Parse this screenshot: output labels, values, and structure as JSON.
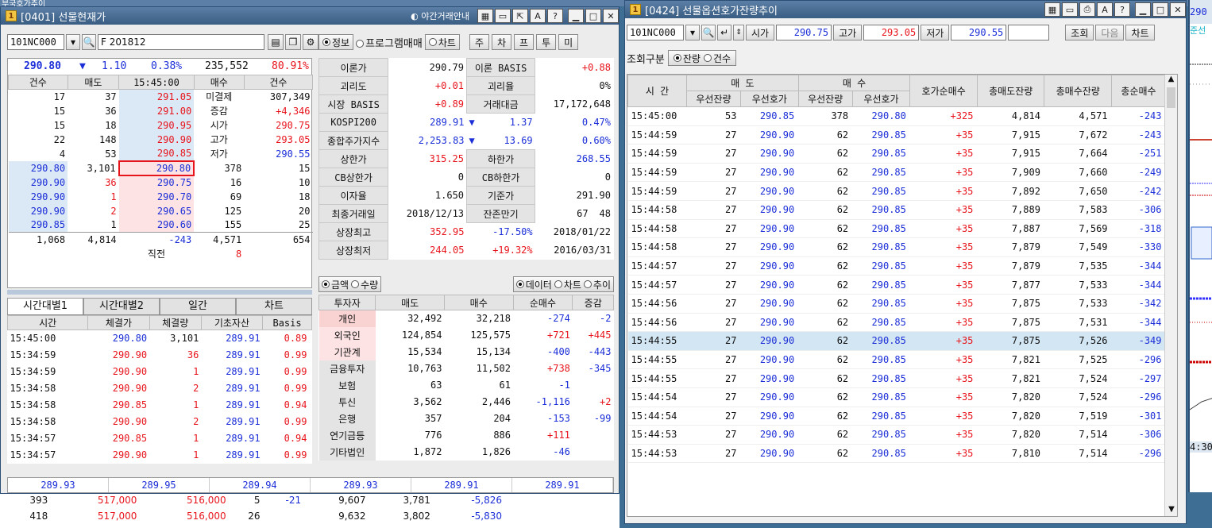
{
  "bg_title": "부국호가추이",
  "w1": {
    "title": "[0401] 선물현재가",
    "night": "야간거래안내",
    "code": "101NC000",
    "name": "F 201812",
    "radios": [
      "정보",
      "프로그램매매",
      "차트"
    ],
    "tabs": [
      "주",
      "차",
      "프",
      "투",
      "미"
    ],
    "hdr": {
      "price": "290.80",
      "chg": "1.10",
      "pct": "0.38%",
      "vol": "235,552",
      "rate": "80.91%"
    },
    "ob_head": [
      "건수",
      "매도",
      "15:45:00",
      "매수",
      "건수"
    ],
    "ask": [
      [
        "17",
        "37",
        "291.05"
      ],
      [
        "15",
        "36",
        "291.00"
      ],
      [
        "15",
        "18",
        "290.95"
      ],
      [
        "22",
        "148",
        "290.90"
      ],
      [
        "4",
        "53",
        "290.85"
      ]
    ],
    "info": [
      [
        "미결제",
        "307,349"
      ],
      [
        "증감",
        "+4,346"
      ],
      [
        "시가",
        "290.75"
      ],
      [
        "고가",
        "293.05"
      ],
      [
        "저가",
        "290.55"
      ]
    ],
    "bid": [
      [
        "290.80",
        "378",
        "15"
      ],
      [
        "290.75",
        "16",
        "10"
      ],
      [
        "290.70",
        "69",
        "18"
      ],
      [
        "290.65",
        "125",
        "20"
      ],
      [
        "290.60",
        "155",
        "25"
      ]
    ],
    "left_ticks": [
      [
        "290.80",
        "3,101"
      ],
      [
        "290.90",
        "36"
      ],
      [
        "290.90",
        "1"
      ],
      [
        "290.90",
        "2"
      ],
      [
        "290.85",
        "1"
      ]
    ],
    "sum": [
      "1,068",
      "4,814",
      "-243",
      "4,571",
      "654"
    ],
    "prev_label": "직전",
    "prev_val": "8",
    "tabs2": [
      "시간대별1",
      "시간대별2",
      "일간",
      "차트"
    ],
    "t_head": [
      "시간",
      "체결가",
      "체결량",
      "기초자산",
      "Basis"
    ],
    "t_rows": [
      [
        "15:45:00",
        "290.80",
        "3,101",
        "289.91",
        "0.89"
      ],
      [
        "15:34:59",
        "290.90",
        "36",
        "289.91",
        "0.99"
      ],
      [
        "15:34:59",
        "290.90",
        "1",
        "289.91",
        "0.99"
      ],
      [
        "15:34:58",
        "290.90",
        "2",
        "289.91",
        "0.99"
      ],
      [
        "15:34:58",
        "290.85",
        "1",
        "289.91",
        "0.94"
      ],
      [
        "15:34:58",
        "290.90",
        "2",
        "289.91",
        "0.99"
      ],
      [
        "15:34:57",
        "290.85",
        "1",
        "289.91",
        "0.94"
      ],
      [
        "15:34:57",
        "290.90",
        "1",
        "289.91",
        "0.99"
      ]
    ],
    "right_info": [
      [
        "이론가",
        "290.79",
        "이론 BASIS",
        "+0.88"
      ],
      [
        "괴리도",
        "+0.01",
        "괴리율",
        "0%"
      ],
      [
        "시장 BASIS",
        "+0.89",
        "거래대금",
        "17,172,648"
      ]
    ],
    "idx": [
      [
        "KOSPI200",
        "289.91",
        "1.37",
        "0.47%"
      ],
      [
        "종합주가지수",
        "2,253.83",
        "13.69",
        "0.60%"
      ]
    ],
    "limits": [
      [
        "상한가",
        "315.25",
        "하한가",
        "268.55"
      ],
      [
        "CB상한가",
        "0",
        "CB하한가",
        "0"
      ],
      [
        "이자율",
        "1.650",
        "기준가",
        "291.90"
      ],
      [
        "최종거래일",
        "2018/12/13",
        "잔존만기",
        "67",
        "48"
      ]
    ],
    "hilo": [
      [
        "상장최고",
        "352.95",
        "-17.50%",
        "2018/01/22"
      ],
      [
        "상장최저",
        "244.05",
        "+19.32%",
        "2016/03/31"
      ]
    ],
    "inv_radios": [
      "금액",
      "수량"
    ],
    "inv_radios2": [
      "데이터",
      "차트",
      "추이"
    ],
    "inv_head": [
      "투자자",
      "매도",
      "매수",
      "순매수",
      "증감"
    ],
    "inv": [
      [
        "개인",
        "32,492",
        "32,218",
        "-274",
        "-2"
      ],
      [
        "외국인",
        "124,854",
        "125,575",
        "+721",
        "+445"
      ],
      [
        "기관계",
        "15,534",
        "15,134",
        "-400",
        "-443"
      ],
      [
        "금융투자",
        "10,763",
        "11,502",
        "+738",
        "-345"
      ],
      [
        "보험",
        "63",
        "61",
        "-1",
        ""
      ],
      [
        "투신",
        "3,562",
        "2,446",
        "-1,116",
        "+2"
      ],
      [
        "은행",
        "357",
        "204",
        "-153",
        "-99"
      ],
      [
        "연기금등",
        "776",
        "886",
        "+111",
        ""
      ],
      [
        "기타법인",
        "1,872",
        "1,826",
        "-46",
        ""
      ]
    ],
    "foot": [
      "289.93",
      "289.95",
      "289.94",
      "289.93",
      "289.91",
      "289.91"
    ]
  },
  "bg_rows": [
    [
      "393",
      "517,000",
      "516,000",
      "5",
      "-21",
      "9,607",
      "3,781",
      "-5,826"
    ],
    [
      "418",
      "517,000",
      "516,000",
      "26",
      "",
      "9,632",
      "3,802",
      "-5,830"
    ]
  ],
  "w2": {
    "title": "[0424] 선물옵션호가잔량추이",
    "code": "101NC000",
    "lbl_open": "시가",
    "open": "290.75",
    "lbl_high": "고가",
    "high": "293.05",
    "lbl_low": "저가",
    "low": "290.55",
    "btn_query": "조회",
    "btn_next": "다음",
    "btn_chart": "차트",
    "cond_label": "조회구분",
    "cond": [
      "잔량",
      "건수"
    ],
    "h_time": "시 간",
    "h_sell": "매 도",
    "h_buy": "매 수",
    "h_sub": [
      "우선잔량",
      "우선호가",
      "우선잔량",
      "우선호가"
    ],
    "h_rest": [
      "호가순매수",
      "총매도잔량",
      "총매수잔량",
      "총순매수"
    ],
    "rows": [
      [
        "15:45:00",
        "53",
        "290.85",
        "378",
        "290.80",
        "+325",
        "4,814",
        "4,571",
        "-243"
      ],
      [
        "15:44:59",
        "27",
        "290.90",
        "62",
        "290.85",
        "+35",
        "7,915",
        "7,672",
        "-243"
      ],
      [
        "15:44:59",
        "27",
        "290.90",
        "62",
        "290.85",
        "+35",
        "7,915",
        "7,664",
        "-251"
      ],
      [
        "15:44:59",
        "27",
        "290.90",
        "62",
        "290.85",
        "+35",
        "7,909",
        "7,660",
        "-249"
      ],
      [
        "15:44:59",
        "27",
        "290.90",
        "62",
        "290.85",
        "+35",
        "7,892",
        "7,650",
        "-242"
      ],
      [
        "15:44:58",
        "27",
        "290.90",
        "62",
        "290.85",
        "+35",
        "7,889",
        "7,583",
        "-306"
      ],
      [
        "15:44:58",
        "27",
        "290.90",
        "62",
        "290.85",
        "+35",
        "7,887",
        "7,569",
        "-318"
      ],
      [
        "15:44:58",
        "27",
        "290.90",
        "62",
        "290.85",
        "+35",
        "7,879",
        "7,549",
        "-330"
      ],
      [
        "15:44:57",
        "27",
        "290.90",
        "62",
        "290.85",
        "+35",
        "7,879",
        "7,535",
        "-344"
      ],
      [
        "15:44:57",
        "27",
        "290.90",
        "62",
        "290.85",
        "+35",
        "7,877",
        "7,533",
        "-344"
      ],
      [
        "15:44:56",
        "27",
        "290.90",
        "62",
        "290.85",
        "+35",
        "7,875",
        "7,533",
        "-342"
      ],
      [
        "15:44:56",
        "27",
        "290.90",
        "62",
        "290.85",
        "+35",
        "7,875",
        "7,531",
        "-344"
      ],
      [
        "15:44:55",
        "27",
        "290.90",
        "62",
        "290.85",
        "+35",
        "7,875",
        "7,526",
        "-349"
      ],
      [
        "15:44:55",
        "27",
        "290.90",
        "62",
        "290.85",
        "+35",
        "7,821",
        "7,525",
        "-296"
      ],
      [
        "15:44:55",
        "27",
        "290.90",
        "62",
        "290.85",
        "+35",
        "7,821",
        "7,524",
        "-297"
      ],
      [
        "15:44:54",
        "27",
        "290.90",
        "62",
        "290.85",
        "+35",
        "7,820",
        "7,524",
        "-296"
      ],
      [
        "15:44:54",
        "27",
        "290.90",
        "62",
        "290.85",
        "+35",
        "7,820",
        "7,519",
        "-301"
      ],
      [
        "15:44:53",
        "27",
        "290.90",
        "62",
        "290.85",
        "+35",
        "7,820",
        "7,514",
        "-306"
      ],
      [
        "15:44:53",
        "27",
        "290.90",
        "62",
        "290.85",
        "+35",
        "7,810",
        "7,514",
        "-296"
      ]
    ]
  },
  "side": {
    "top": "290",
    "sub": "준선",
    "mid": "4:30"
  },
  "colors": {
    "up": "#e8141c",
    "down": "#1b2ed8",
    "ask_bg": "#dbe8f5",
    "bid_bg": "#fde3e3"
  }
}
